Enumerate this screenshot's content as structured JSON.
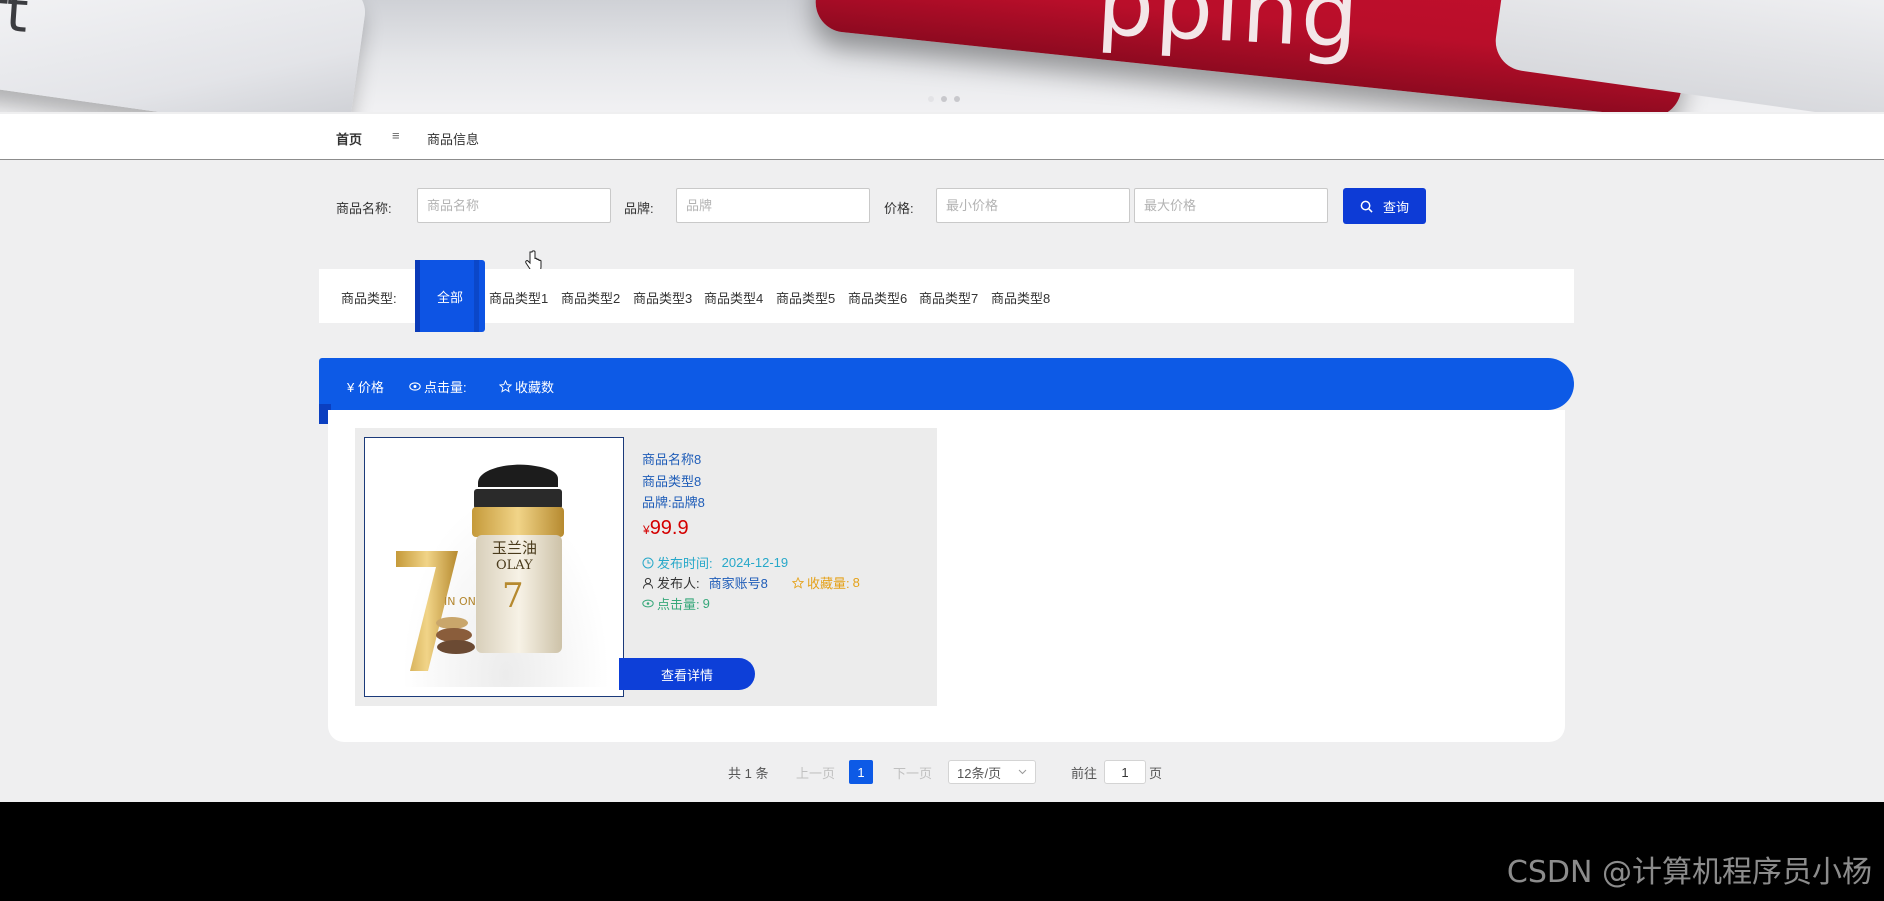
{
  "banner": {
    "key_left_text": "ift",
    "key_right_text": "pping",
    "slides": 3,
    "active_slide": 1
  },
  "navbar": {
    "home": "首页",
    "separator": "≡",
    "current": "商品信息"
  },
  "search": {
    "name_label": "商品名称:",
    "name_placeholder": "商品名称",
    "brand_label": "品牌:",
    "brand_placeholder": "品牌",
    "price_label": "价格:",
    "min_placeholder": "最小价格",
    "max_placeholder": "最大价格",
    "button_label": "查询"
  },
  "types": {
    "label": "商品类型:",
    "active": "全部",
    "items": [
      "商品类型1",
      "商品类型2",
      "商品类型3",
      "商品类型4",
      "商品类型5",
      "商品类型6",
      "商品类型7",
      "商品类型8"
    ]
  },
  "sort": {
    "price": "¥ 价格",
    "clicks": "点击量:",
    "favorites": "收藏数"
  },
  "product": {
    "name": "商品名称8",
    "type": "商品类型8",
    "brand": "品牌:品牌8",
    "currency": "¥",
    "price": "99.9",
    "publish_label": "发布时间:",
    "publish_date": "2024-12-19",
    "publisher_label": "发布人:",
    "publisher": "商家账号8",
    "fav_label": "收藏量:",
    "fav_count": "8",
    "click_label": "点击量:",
    "click_count": "9",
    "detail_button": "查看详情",
    "image_text": {
      "brand_cn": "玉兰油",
      "brand_en": "OLAY",
      "big_number": "7",
      "in_one": "IN ONE"
    }
  },
  "pagination": {
    "total": "共 1 条",
    "prev": "上一页",
    "current_page": "1",
    "next": "下一页",
    "page_size": "12条/页",
    "goto_label": "前往",
    "goto_value": "1",
    "page_unit": "页"
  },
  "watermark": "CSDN @计算机程序员小杨",
  "colors": {
    "primary": "#0d5ae6",
    "dark_primary": "#0d3bd6",
    "price": "#d40000",
    "footer": "#000000"
  }
}
